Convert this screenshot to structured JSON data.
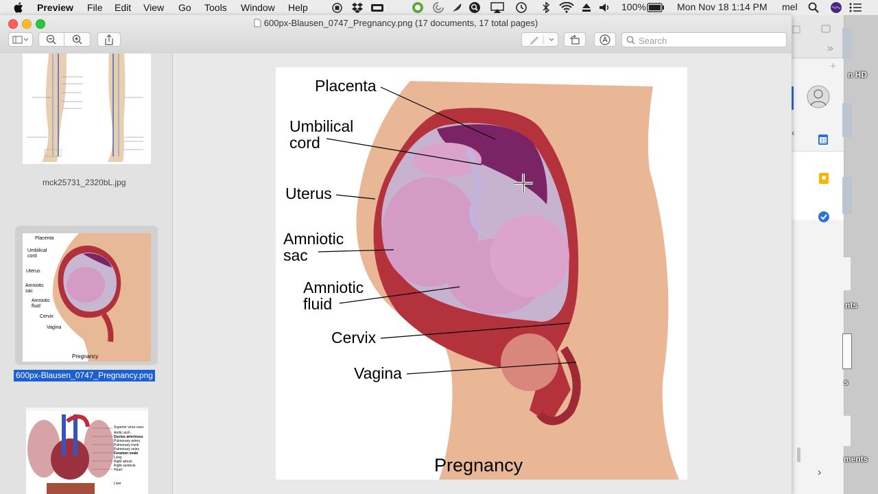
{
  "menubar": {
    "app_name": "Preview",
    "items": [
      "File",
      "Edit",
      "View",
      "Go",
      "Tools",
      "Window",
      "Help"
    ],
    "battery": "100%",
    "datetime": "Mon Nov 18  1:14 PM",
    "user": "mel"
  },
  "window": {
    "title": "600px-Blausen_0747_Pregnancy.png (17 documents, 17 total pages)"
  },
  "search": {
    "placeholder": "Search"
  },
  "sidebar": {
    "thumbnails": [
      {
        "caption": "mck25731_2320bL.jpg"
      },
      {
        "caption": "600px-Blausen_0747_Pregnancy.png",
        "labels": [
          "Placenta",
          "Umbilical",
          "cord",
          "Uterus",
          "Amniotic",
          "sac",
          "Amniotic",
          "fluid",
          "Cervix",
          "Vagina"
        ],
        "title": "Pregnancy"
      },
      {
        "labels": [
          "Superior vena cava",
          "Aortic arch",
          "Ductus arteriosus",
          "Pulmonary artery",
          "Pulmonary trunk",
          "Pulmonary veins",
          "Foramen ovale",
          "Lung",
          "Right atrium",
          "Right ventricle",
          "Heart",
          "Liver"
        ]
      }
    ]
  },
  "document": {
    "labels": {
      "placenta": "Placenta",
      "umbilical_1": "Umbilical",
      "umbilical_2": "cord",
      "uterus": "Uterus",
      "amniotic_sac_1": "Amniotic",
      "amniotic_sac_2": "sac",
      "amniotic_fluid_1": "Amniotic",
      "amniotic_fluid_2": "fluid",
      "cervix": "Cervix",
      "vagina": "Vagina"
    },
    "title": "Pregnancy"
  },
  "desktop": {
    "labels": [
      "n HD",
      "nts",
      "s",
      "ments"
    ],
    "calendar_day": "31"
  },
  "colors": {
    "selection": "#1c5fd1",
    "tl_close": "#fc5f57",
    "tl_min": "#fdbc2e",
    "tl_max": "#28c840",
    "skin": "#e9b796",
    "uterus_wall": "#b3323c",
    "placenta": "#7a2466",
    "fetus": "#d39bc6"
  }
}
